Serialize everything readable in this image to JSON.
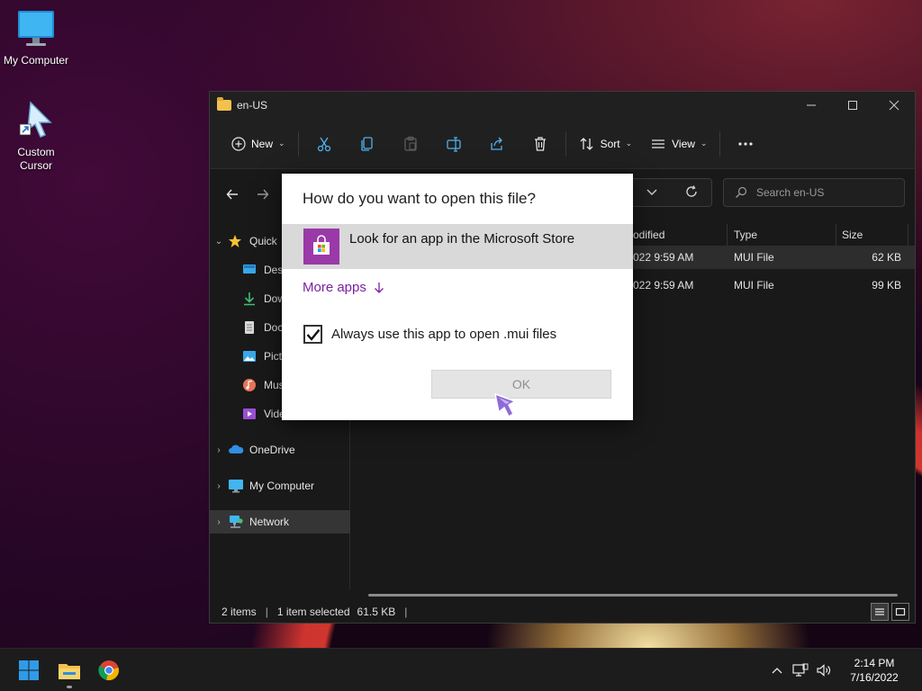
{
  "desktop": {
    "icons": [
      {
        "label": "My Computer"
      },
      {
        "label": "Custom Cursor"
      }
    ]
  },
  "explorer": {
    "title": "en-US",
    "toolbar": {
      "new_label": "New",
      "sort_label": "Sort",
      "view_label": "View"
    },
    "search": {
      "placeholder": "Search en-US"
    },
    "nav": {
      "quick_access": "Quick",
      "items": [
        {
          "label": "Desk"
        },
        {
          "label": "Dow"
        },
        {
          "label": "Doc"
        },
        {
          "label": "Pict"
        },
        {
          "label": "Mus"
        },
        {
          "label": "Vide"
        }
      ],
      "onedrive": "OneDrive",
      "my_computer": "My Computer",
      "network": "Network"
    },
    "columns": {
      "modified": "odified",
      "type": "Type",
      "size": "Size"
    },
    "rows": [
      {
        "modified": "022 9:59 AM",
        "type": "MUI File",
        "size": "62 KB",
        "selected": true
      },
      {
        "modified": "022 9:59 AM",
        "type": "MUI File",
        "size": "99 KB",
        "selected": false
      }
    ],
    "status": {
      "items": "2 items",
      "selection": "1 item selected",
      "selection_size": "61.5 KB"
    }
  },
  "dialog": {
    "title": "How do you want to open this file?",
    "option_label": "Look for an app in the Microsoft Store",
    "more_apps": "More apps",
    "always_label": "Always use this app to open .mui files",
    "always_checked": true,
    "ok_label": "OK"
  },
  "taskbar": {
    "apps": [
      "windows-start",
      "file-explorer",
      "chrome"
    ],
    "time": "2:14 PM",
    "date": "7/16/2022"
  },
  "colors": {
    "accent_purple": "#7b1fa2",
    "store_tile": "#9a39a8",
    "folder_yellow": "#f2c14e"
  }
}
